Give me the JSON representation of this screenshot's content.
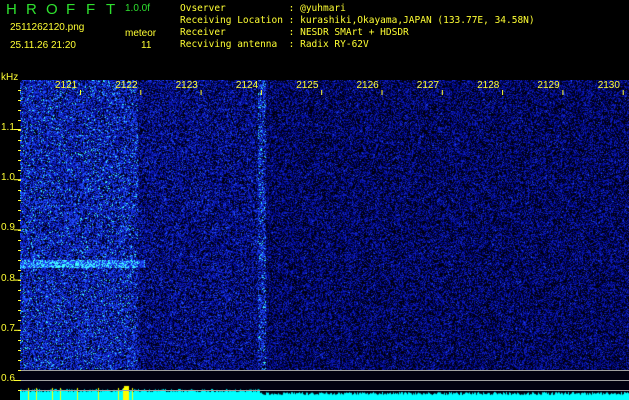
{
  "header": {
    "logo_letters": [
      "H",
      "R",
      "O",
      "F",
      "F",
      "T"
    ],
    "version": "1.0.0f",
    "filename": "2511262120.png",
    "datetime": "25.11.26 21:20",
    "meteor_label": "meteor",
    "meteor_count": "11"
  },
  "info": [
    {
      "label": "Ovserver           ",
      "value": ": @yuhmari"
    },
    {
      "label": "Receiving Location ",
      "value": ": kurashiki,Okayama,JAPAN (133.77E, 34.58N)"
    },
    {
      "label": "Receiver           ",
      "value": ": NESDR SMArt + HDSDR"
    },
    {
      "label": "Recviving antenna  ",
      "value": ": Radix RY-62V"
    }
  ],
  "spectrogram": {
    "y_unit": "kHz",
    "time_ticks": [
      "2121",
      "2122",
      "2123",
      "2124",
      "2125",
      "2126",
      "2127",
      "2128",
      "2129",
      "2130"
    ],
    "freq_ticks": [
      "1.1",
      "1.0",
      "0.9",
      "0.8",
      "0.7",
      "0.6"
    ],
    "colors": {
      "low": "#000060",
      "mid": "#2040ff",
      "high": "#40ffff",
      "meter": "#00ffff",
      "peak": "#ffff00",
      "guide": "#a0a0a0"
    }
  }
}
